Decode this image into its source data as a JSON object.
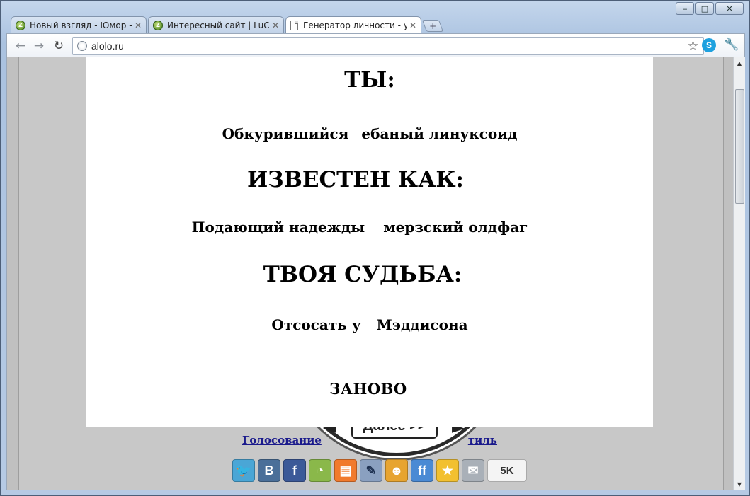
{
  "window": {
    "minimize": "‒",
    "maximize": "□",
    "close": "✕"
  },
  "tabs": [
    {
      "title": "Новый взгляд - Юмор - ...",
      "active": false
    },
    {
      "title": "Интересный сайт | LuCk...",
      "active": false
    },
    {
      "title": "Генератор личности - у...",
      "active": true
    }
  ],
  "toolbar": {
    "back": "←",
    "forward": "→",
    "reload": "↻",
    "url": "alolo.ru",
    "star": "☆",
    "skype": "S",
    "wrench": "🔧"
  },
  "modal": {
    "heading_you": "ТЫ:",
    "you_value_a": "Обкурившийся",
    "you_value_b": "ебаный линуксоид",
    "heading_known": "ИЗВЕСТЕН КАК:",
    "known_value_a": "Подающий надежды",
    "known_value_b": "мерзский олдфаг",
    "heading_fate": "ТВОЯ СУДЬБА:",
    "fate_value_a": "Отсосать у",
    "fate_value_b": "Мэддисона",
    "again": "ЗАНОВО"
  },
  "page": {
    "next_button": "Далее >>",
    "vote_left": "Голосование",
    "vote_right": "тиль"
  },
  "share": {
    "icons": [
      "twitter-icon",
      "vkontakte-icon",
      "facebook-icon",
      "google-buzz-icon",
      "blogger-icon",
      "livejournal-icon",
      "mymail-icon",
      "friendfeed-icon",
      "favorites-icon",
      "email-icon"
    ],
    "vk": "В",
    "fb": "f",
    "ff": "ff",
    "count": "5K"
  },
  "colors": {
    "link": "#1a1a8c",
    "page_background": "#c8c8c8"
  }
}
